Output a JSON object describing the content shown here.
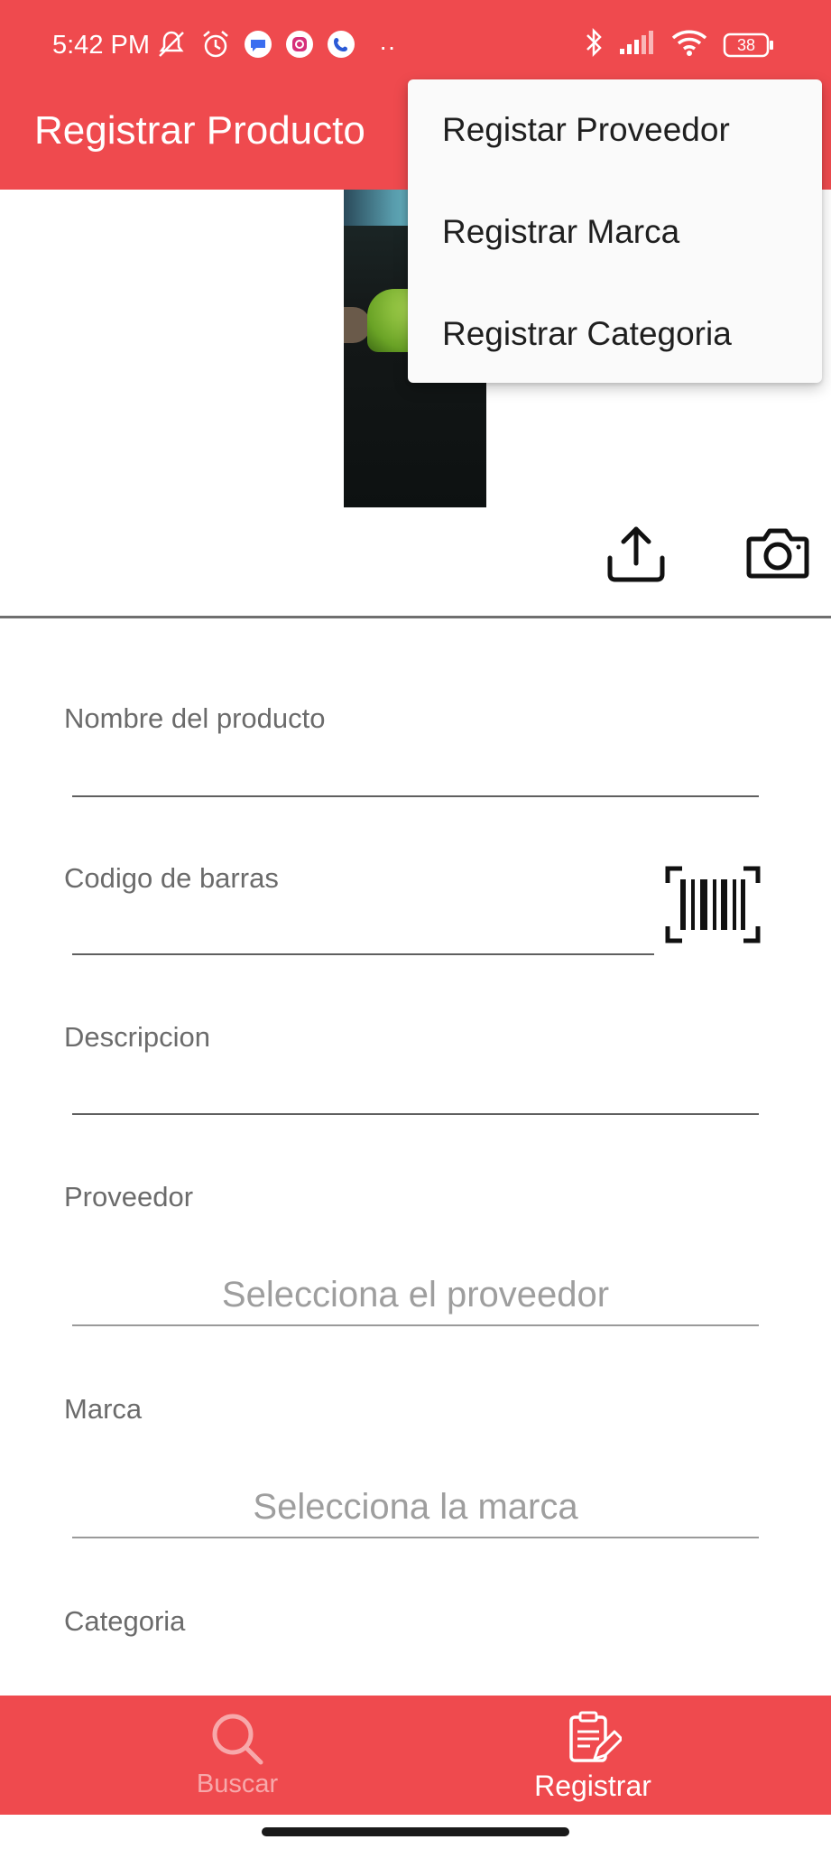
{
  "status_bar": {
    "time": "5:42 PM",
    "battery": "38",
    "overflow": "··",
    "left_icons": [
      "mute-icon",
      "alarm-icon",
      "message-icon",
      "instagram-icon",
      "phone-icon"
    ],
    "right_icons": [
      "bluetooth-icon",
      "signal-icon",
      "wifi-icon",
      "battery-icon"
    ]
  },
  "app_bar": {
    "title": "Registrar Producto"
  },
  "overflow_menu": {
    "items": [
      {
        "label": "Registar Proveedor"
      },
      {
        "label": "Registrar Marca"
      },
      {
        "label": "Registrar Categoria"
      }
    ]
  },
  "image_section": {
    "icons": [
      "upload-icon",
      "camera-icon"
    ]
  },
  "form": {
    "nombre": {
      "label": "Nombre del producto",
      "value": ""
    },
    "codigo": {
      "label": "Codigo de barras",
      "value": ""
    },
    "descripcion": {
      "label": "Descripcion",
      "value": ""
    },
    "proveedor": {
      "label": "Proveedor",
      "placeholder": "Selecciona el proveedor"
    },
    "marca": {
      "label": "Marca",
      "placeholder": "Selecciona la marca"
    },
    "categoria": {
      "label": "Categoria"
    }
  },
  "bottom_nav": {
    "items": [
      {
        "label": "Buscar",
        "icon": "search-icon",
        "active": false
      },
      {
        "label": "Registrar",
        "icon": "clipboard-edit-icon",
        "active": true
      }
    ]
  },
  "colors": {
    "primary": "#ef4a4e",
    "inactive_nav": "#f7a8aa",
    "menu_bg": "#fafafa",
    "label": "#6b6b6b",
    "placeholder": "#9e9e9e"
  }
}
